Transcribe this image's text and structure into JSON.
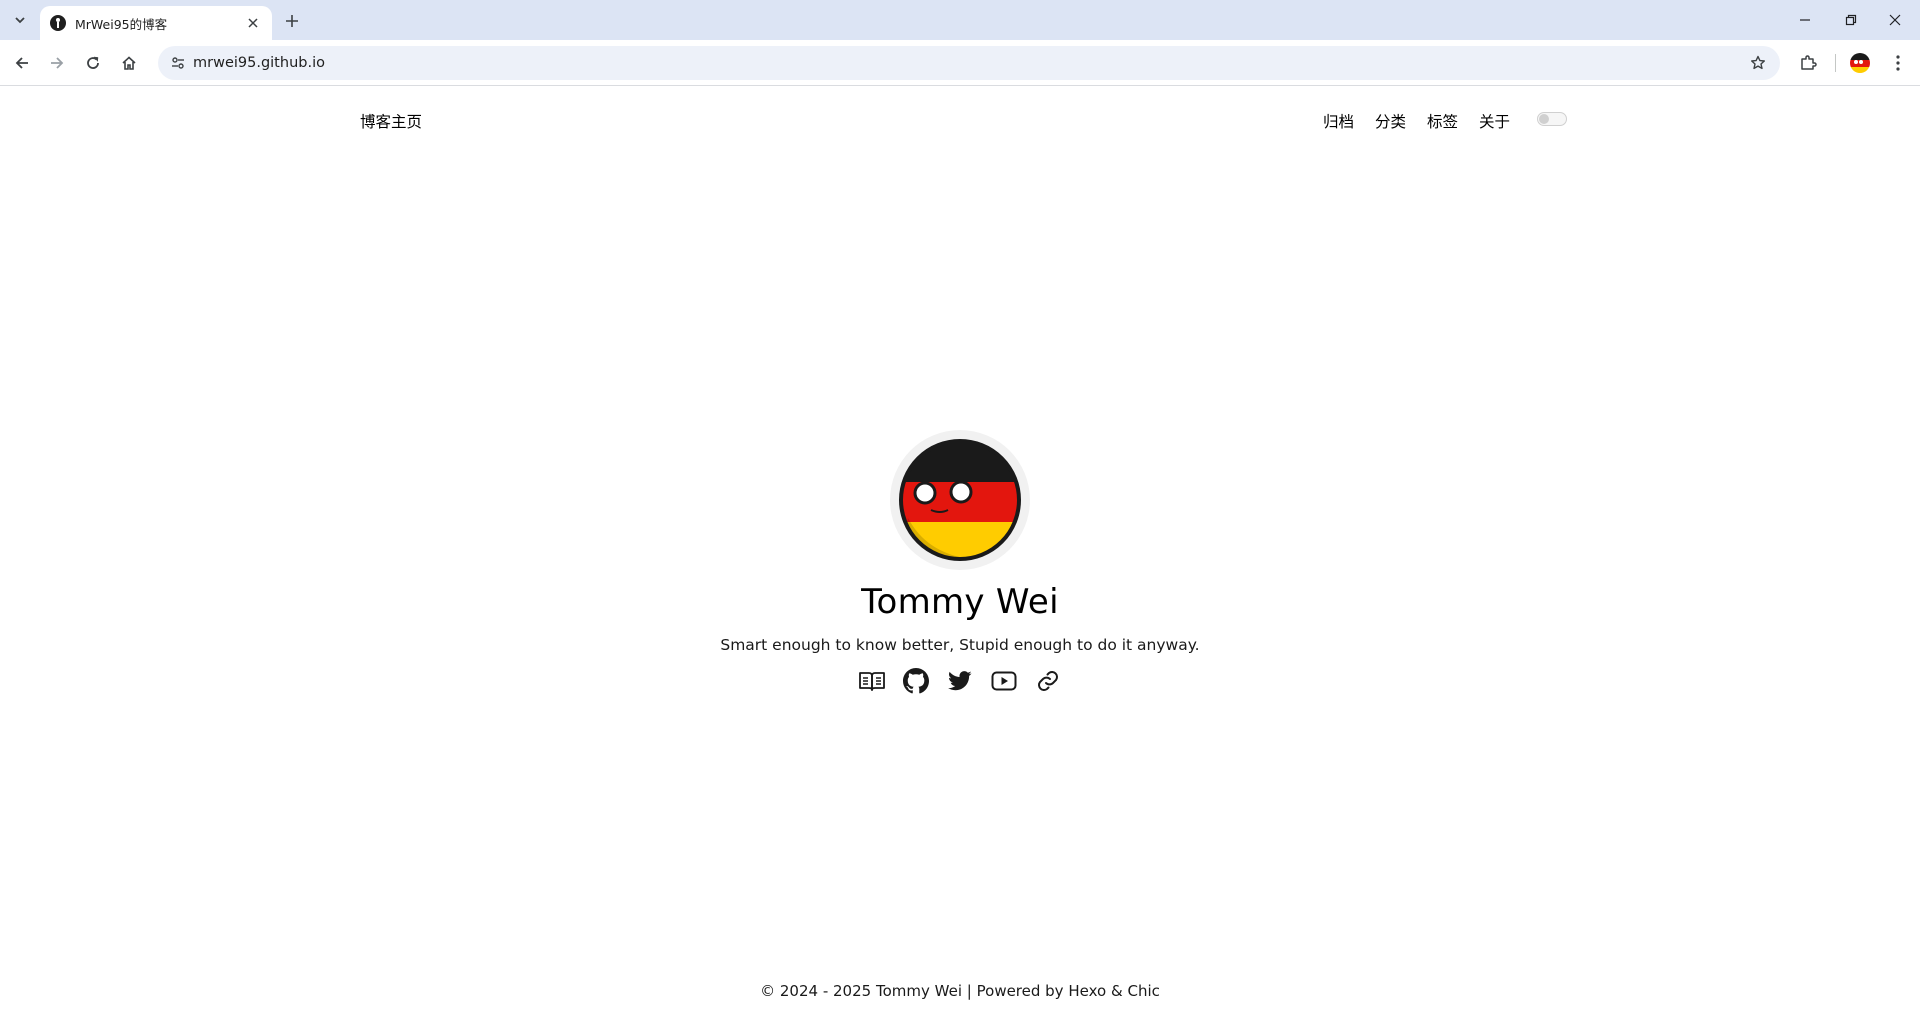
{
  "browser": {
    "tab": {
      "title": "MrWei95的博客"
    },
    "address": {
      "url": "mrwei95.github.io"
    }
  },
  "site": {
    "brand": "博客主页",
    "nav": [
      {
        "label": "归档"
      },
      {
        "label": "分类"
      },
      {
        "label": "标签"
      },
      {
        "label": "关于"
      }
    ],
    "theme_toggle": {
      "state": "off"
    }
  },
  "profile": {
    "name": "Tommy Wei",
    "bio": "Smart enough to know better, Stupid enough to do it anyway.",
    "social_icons": [
      "book-icon",
      "github-icon",
      "twitter-icon",
      "youtube-icon",
      "link-icon"
    ]
  },
  "footer": {
    "copyright": "© 2024 - 2025",
    "author": "Tommy Wei",
    "separator": "|",
    "powered_prefix": "Powered by",
    "hexo": "Hexo",
    "amp": "&",
    "chic": "Chic"
  },
  "colors": {
    "tabstrip": "#dce4f4",
    "omnibox": "#edf1f9",
    "flag_black": "#1a1a1a",
    "flag_red": "#e3160e",
    "flag_gold": "#ffcc00"
  }
}
